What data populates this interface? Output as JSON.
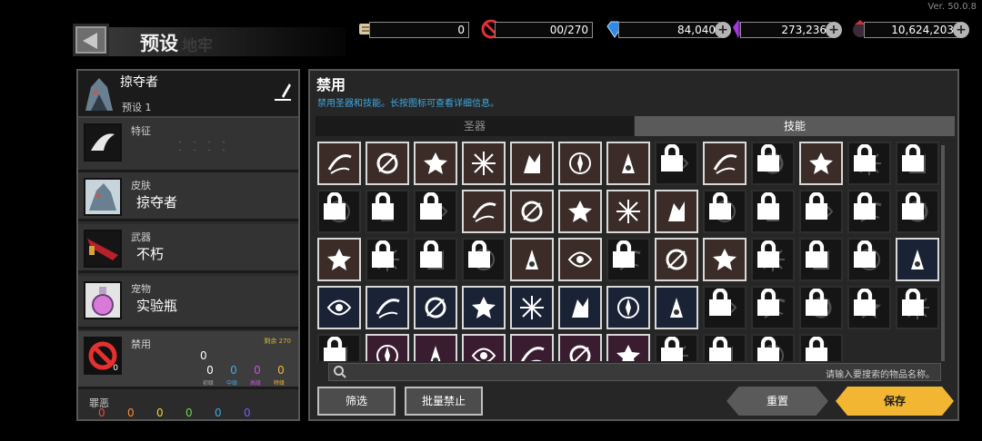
{
  "version": "Ver. 50.0.8",
  "header": {
    "title": "预设",
    "title_ghost": "地牢"
  },
  "resources": [
    {
      "icon": "scroll-icon",
      "value": "0",
      "has_plus": false
    },
    {
      "icon": "ban-icon",
      "value": "00/270",
      "has_plus": false
    },
    {
      "icon": "blue-gem-icon",
      "value": "84,040",
      "has_plus": true
    },
    {
      "icon": "purple-crystal-icon",
      "value": "273,236",
      "has_plus": true
    },
    {
      "icon": "dark-orb-icon",
      "value": "10,624,203",
      "has_plus": true
    }
  ],
  "preset": {
    "name": "掠夺者",
    "sub": "预设 1"
  },
  "loadout": {
    "trait": {
      "label": "特征"
    },
    "skin": {
      "label": "皮肤",
      "value": "掠夺者"
    },
    "weapon": {
      "label": "武器",
      "value": "不朽"
    },
    "pet": {
      "label": "宠物",
      "value": "实验瓶"
    },
    "ban": {
      "label": "禁用",
      "remaining": "剩余 270",
      "count": "0",
      "corner_count": "0",
      "tier_nums": [
        "0",
        "0",
        "0",
        "0"
      ],
      "tier_labels": [
        "初级",
        "中级",
        "高级",
        "特级"
      ]
    },
    "sin": {
      "label": "罪恶",
      "nums": [
        "0",
        "0",
        "0",
        "0",
        "0",
        "0",
        "0"
      ]
    }
  },
  "panel": {
    "title": "禁用",
    "subtitle": "禁用圣器和技能。长按图标可查看详细信息。",
    "tabs": {
      "artifact": "圣器",
      "skill": "技能"
    },
    "search_placeholder": "请输入要搜索的物品名称。",
    "buttons": {
      "filter": "筛选",
      "bulk_ban": "批量禁止",
      "reset": "重置",
      "save": "保存"
    }
  },
  "colors": {
    "accent_blue": "#3fa9e0",
    "save_yellow": "#f2b632",
    "cell_brown": "#3b2c28",
    "cell_blue": "#1a2236",
    "cell_purple": "#3a1c30"
  },
  "skill_icons": [
    [
      "slash-arc-icon",
      "sword-swing-icon",
      "star-burst-icon",
      "shatter-icon",
      "double-arrow-up-icon",
      "compass-icon",
      "flask-flame-icon",
      "wreath-icon",
      "trident-icon",
      "claw-shadow-icon",
      "white-wing-icon",
      "dagger-fan-icon",
      "shadow-beast-icon"
    ],
    [
      "spark-cross-icon",
      "broken-sword-icon",
      "vortex-icon",
      "target-ring-icon",
      "whirl-blade-icon",
      "beast-skull-icon",
      "scroll-bundle-icon",
      "ring-flash-icon",
      "feather-icon",
      "rune-circle-icon",
      "twin-blades-icon",
      "blade-rain-icon",
      "crossed-axes-icon"
    ],
    [
      "heartbeat-icon",
      "dark-flame-icon",
      "grass-spikes-icon",
      "serpent-icon",
      "flame-burst-icon",
      "spear-strike-icon",
      "dark-needles-icon",
      "spiral-eye-icon",
      "crystal-shard-icon",
      "bat-wing-icon",
      "shadow-spear-icon",
      "helm-beast-icon",
      "triple-orb-icon"
    ],
    [
      "splash-blast-icon",
      "blade-climb-icon",
      "arrow-volley-icon",
      "spider-rune-icon",
      "skull-mark-icon",
      "crossed-spears-icon",
      "whirlpool-icon",
      "swirl-wind-icon",
      "shield-crest-icon",
      "thunder-ring-icon",
      "broken-heart-icon",
      "owl-spirit-icon",
      "moon-mask-icon"
    ],
    [
      "crow-icon",
      "dark-vortex-icon",
      "crescent-icon",
      "star-shard-icon",
      "sun-ring-icon",
      "tower-icon",
      "ghost-ring-icon",
      "dark-crown-icon",
      "saw-ring-icon",
      "claw-mark-icon",
      "mask-icon",
      "",
      ""
    ]
  ],
  "skill_states": [
    [
      "brown",
      "brown",
      "brown",
      "brown",
      "brown",
      "brown",
      "brown",
      "locked",
      "brown",
      "locked",
      "brown",
      "locked",
      "locked"
    ],
    [
      "locked",
      "locked",
      "locked",
      "brown",
      "brown",
      "brown",
      "brown",
      "brown",
      "locked",
      "locked",
      "locked",
      "locked",
      "locked"
    ],
    [
      "brown",
      "locked",
      "locked",
      "locked",
      "brown",
      "brown",
      "locked",
      "brown",
      "brown",
      "locked",
      "locked",
      "locked",
      "blue"
    ],
    [
      "blue",
      "blue",
      "blue",
      "blue",
      "blue",
      "blue",
      "blue",
      "blue",
      "locked",
      "locked",
      "locked",
      "locked",
      "locked"
    ],
    [
      "locked",
      "purple",
      "purple",
      "purple",
      "purple",
      "purple",
      "purple",
      "locked",
      "locked",
      "locked",
      "locked",
      "none",
      "none"
    ]
  ]
}
